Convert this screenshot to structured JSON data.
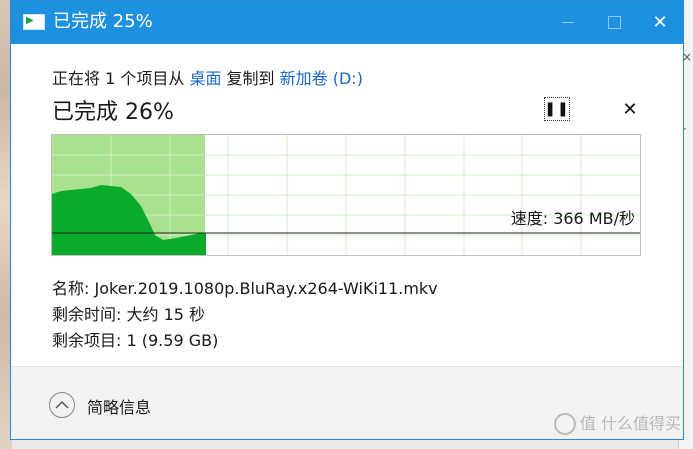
{
  "window": {
    "title": "已完成 25%"
  },
  "copy": {
    "prefix": "正在将 1 个项目从 ",
    "source": "桌面",
    "middle": " 复制到 ",
    "destination": "新加卷 (D:)",
    "progress_title": "已完成 26%",
    "percent_complete": 26
  },
  "graph": {
    "speed_text": "速度: 366 MB/秒",
    "fill_color": "#a8e28f",
    "speed_color": "#0aaa2a",
    "grid_color": "#cfeec4"
  },
  "details": {
    "name_label": "名称: ",
    "name_value": "Joker.2019.1080p.BluRay.x264-WiKi11.mkv",
    "time_label": "剩余时间: ",
    "time_value": "大约 15 秒",
    "items_label": "剩余项目: ",
    "items_value": "1 (9.59 GB)"
  },
  "footer": {
    "collapse_label": "简略信息"
  },
  "watermark": {
    "text": "值 什么值得买"
  },
  "icons": {
    "pause": "pause-icon",
    "close": "close-icon",
    "chevron": "chevron-up-icon"
  }
}
